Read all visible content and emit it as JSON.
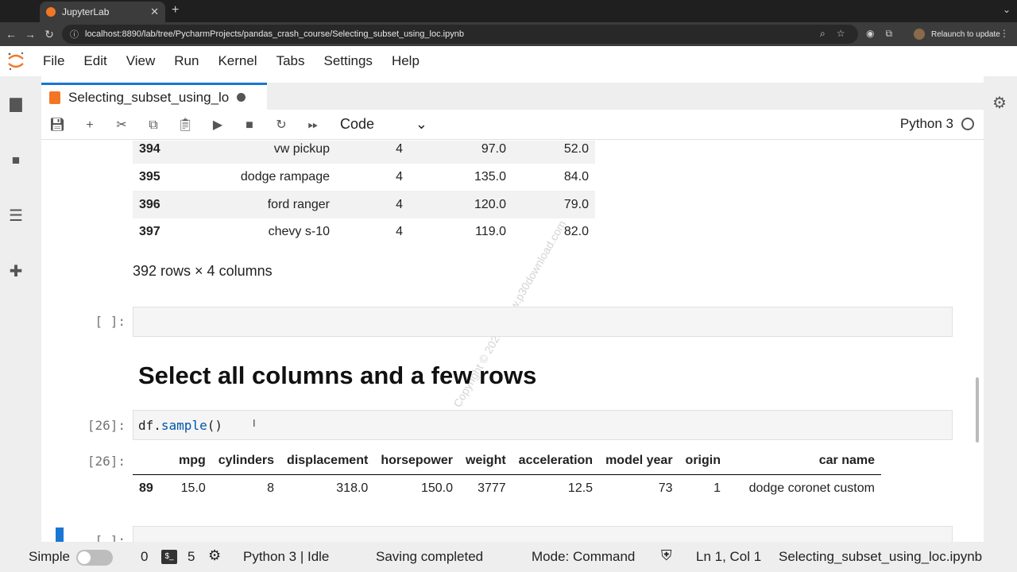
{
  "browser": {
    "tab_title": "JupyterLab",
    "url": "localhost:8890/lab/tree/PycharmProjects/pandas_crash_course/Selecting_subset_using_loc.ipynb",
    "relaunch_label": "Relaunch to update"
  },
  "menu": [
    "File",
    "Edit",
    "View",
    "Run",
    "Kernel",
    "Tabs",
    "Settings",
    "Help"
  ],
  "notebook_tab": {
    "title": "Selecting_subset_using_lo"
  },
  "toolbar": {
    "cell_type": "Code",
    "kernel_name": "Python 3"
  },
  "output_table": {
    "rows": [
      {
        "index": "394",
        "name": "vw pickup",
        "cylinders": "4",
        "displacement": "97.0",
        "horsepower": "52.0"
      },
      {
        "index": "395",
        "name": "dodge rampage",
        "cylinders": "4",
        "displacement": "135.0",
        "horsepower": "84.0"
      },
      {
        "index": "396",
        "name": "ford ranger",
        "cylinders": "4",
        "displacement": "120.0",
        "horsepower": "79.0"
      },
      {
        "index": "397",
        "name": "chevy s-10",
        "cylinders": "4",
        "displacement": "119.0",
        "horsepower": "82.0"
      }
    ],
    "shape": "392 rows × 4 columns"
  },
  "empty_cell": {
    "prompt": "[ ]:"
  },
  "markdown": {
    "heading": "Select all columns and a few rows"
  },
  "code_cell": {
    "prompt": "[26]:",
    "code_obj": "df.",
    "code_method": "sample",
    "code_parens": "()",
    "out_prompt": "[26]:"
  },
  "sample_table": {
    "headers": [
      "",
      "mpg",
      "cylinders",
      "displacement",
      "horsepower",
      "weight",
      "acceleration",
      "model year",
      "origin",
      "car name"
    ],
    "row": [
      "89",
      "15.0",
      "8",
      "318.0",
      "150.0",
      "3777",
      "12.5",
      "73",
      "1",
      "dodge coronet custom"
    ]
  },
  "next_prompt": "[ ]:",
  "watermark": "Copyright © 2025 - www.p30download.com",
  "status": {
    "mode_label": "Simple",
    "terminals": "0",
    "kernels": "5",
    "kernel_status": "Python 3 | Idle",
    "save_status": "Saving completed",
    "mode": "Mode: Command",
    "cursor": "Ln 1, Col 1",
    "filename": "Selecting_subset_using_loc.ipynb"
  },
  "colors": {
    "accent": "#1976d2",
    "jupyter_orange": "#f37626"
  }
}
